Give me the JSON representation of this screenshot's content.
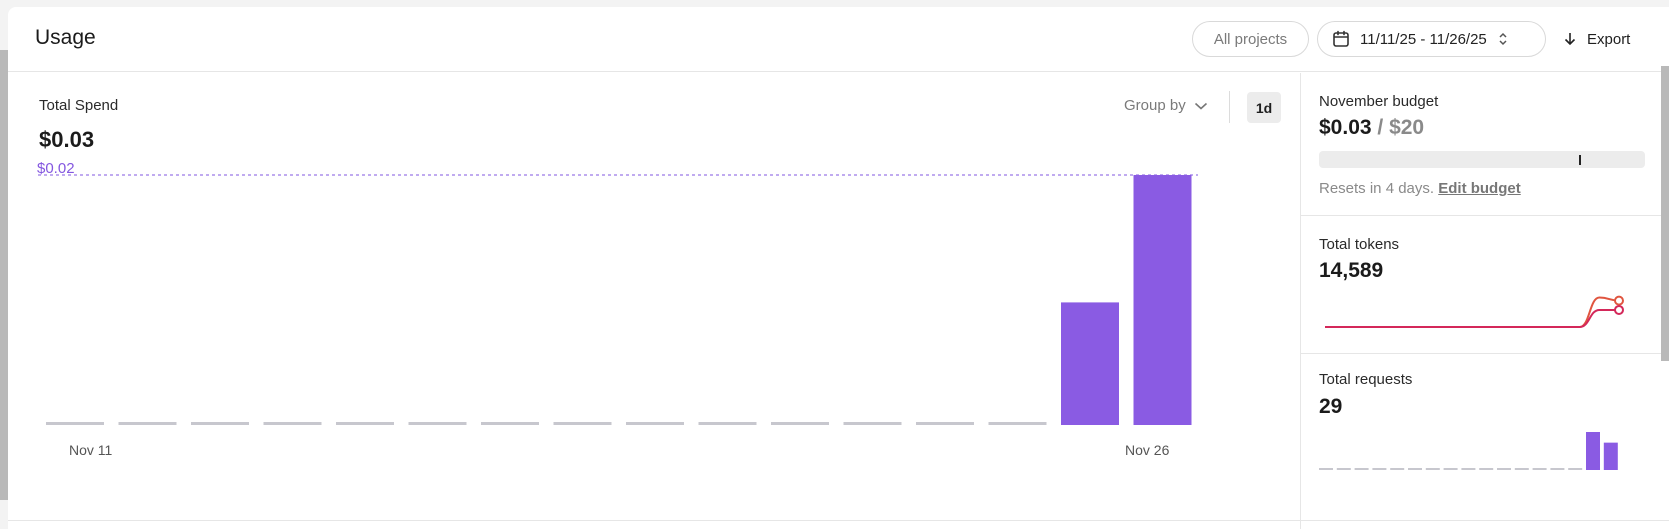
{
  "header": {
    "title": "Usage",
    "projects_filter": "All projects",
    "date_range": "11/11/25 - 11/26/25",
    "export_label": "Export"
  },
  "spend": {
    "label": "Total Spend",
    "value": "$0.03",
    "group_by_label": "Group by",
    "range_label": "1d",
    "budget_line_label": "$0.02"
  },
  "budget": {
    "label": "November budget",
    "spent": "$0.03",
    "separator": " / ",
    "total": "$20",
    "note": "Resets in 4 days.",
    "edit_link": "Edit budget"
  },
  "tokens": {
    "label": "Total tokens",
    "value": "14,589"
  },
  "requests": {
    "label": "Total requests",
    "value": "29"
  },
  "colors": {
    "accent": "#8257e0",
    "bar": "#8a5be3",
    "zero_bar": "#c7c7ce",
    "token_line_1": "#e0553f",
    "token_line_2": "#d4285a"
  },
  "chart_data": {
    "type": "bar",
    "x_tick_labels": [
      "Nov 11",
      "Nov 26"
    ],
    "values": [
      0,
      0,
      0,
      0,
      0,
      0,
      0,
      0,
      0,
      0,
      0,
      0,
      0,
      0,
      0.0102,
      0.0208
    ],
    "reference_line": 0.0208,
    "ylim": [
      0,
      0.0208
    ]
  },
  "tokens_sparkline": {
    "series_1": [
      0,
      0,
      0,
      0,
      0,
      0,
      0,
      0,
      0,
      0,
      0,
      0,
      0,
      0,
      0.95,
      0.85
    ],
    "series_2": [
      0,
      0,
      0,
      0,
      0,
      0,
      0,
      0,
      0,
      0,
      0,
      0,
      0,
      0,
      0.55,
      0.55
    ]
  },
  "requests_bars": [
    0,
    0,
    0,
    0,
    0,
    0,
    0,
    0,
    0,
    0,
    0,
    0,
    0,
    0,
    0,
    1,
    0.72
  ]
}
